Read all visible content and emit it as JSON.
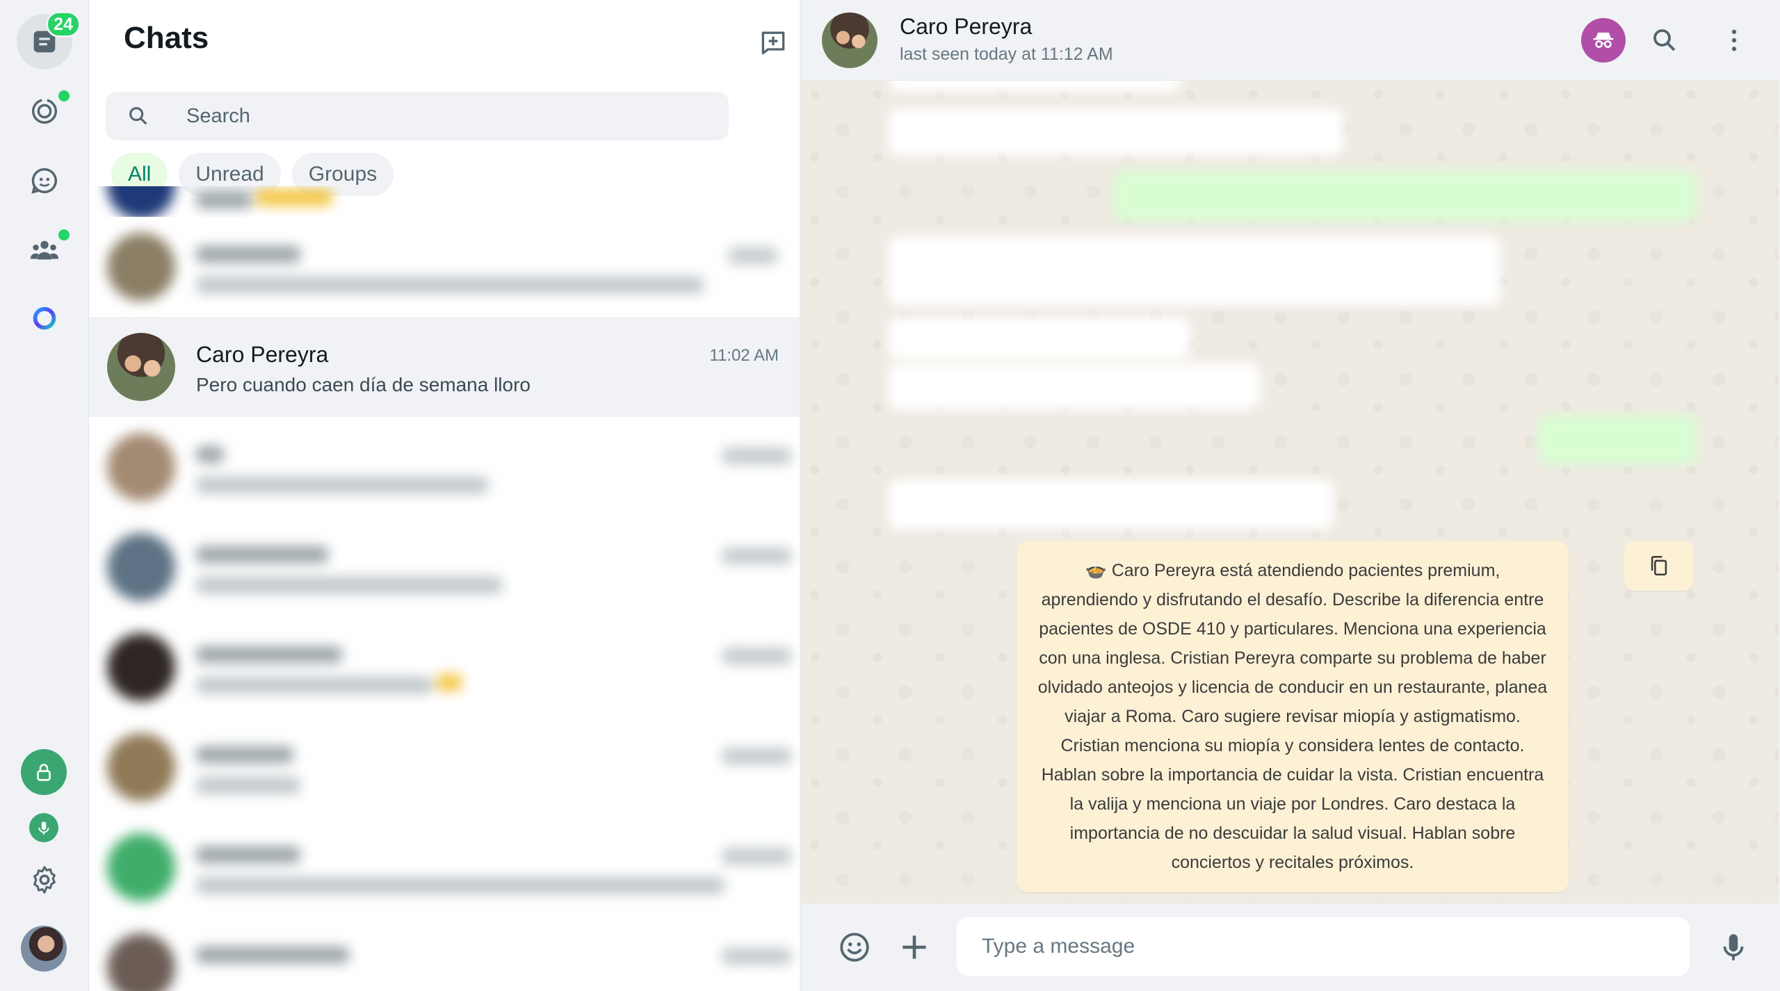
{
  "rail": {
    "chats_badge": "24",
    "items": [
      {
        "name": "chats",
        "icon": "chats-icon"
      },
      {
        "name": "status",
        "icon": "status-icon"
      },
      {
        "name": "channels",
        "icon": "channels-icon"
      },
      {
        "name": "communities",
        "icon": "communities-icon"
      },
      {
        "name": "meta-ai",
        "icon": "meta-ai-ring-icon"
      }
    ],
    "bottom": [
      {
        "name": "lock",
        "icon": "lock-icon"
      },
      {
        "name": "voice",
        "icon": "mic-badge-icon"
      },
      {
        "name": "settings",
        "icon": "gear-icon"
      },
      {
        "name": "profile",
        "icon": "profile-avatar"
      }
    ],
    "accent": "#25d366"
  },
  "list": {
    "title": "Chats",
    "search_placeholder": "Search",
    "filters": [
      "All",
      "Unread",
      "Groups"
    ],
    "active_filter": "All",
    "selected_chat": {
      "name": "Caro Pereyra",
      "last_message": "Pero cuando caen día de semana lloro",
      "time": "11:02 AM"
    }
  },
  "chat": {
    "contact_name": "Caro Pereyra",
    "status": "last seen today at 11:12 AM",
    "summary": "🍲 Caro Pereyra está atendiendo pacientes premium, aprendiendo y disfrutando el desafío. Describe la diferencia entre pacientes de OSDE 410 y particulares. Menciona una experiencia con una inglesa. Cristian Pereyra comparte su problema de haber olvidado anteojos y licencia de conducir en un restaurante, planea viajar a Roma. Caro sugiere revisar miopía y astigmatismo. Cristian menciona su miopía y considera lentes de contacto. Hablan sobre la importancia de cuidar la vista. Cristian encuentra la valija y menciona un viaje por Londres. Caro destaca la importancia de no descuidar la salud visual. Hablan sobre conciertos y recitales próximos.",
    "composer_placeholder": "Type a message",
    "colors": {
      "summary_bg": "#fcf1d5",
      "incognito": "#b04ea8",
      "outgoing_bubble": "#d9fdd3"
    }
  }
}
